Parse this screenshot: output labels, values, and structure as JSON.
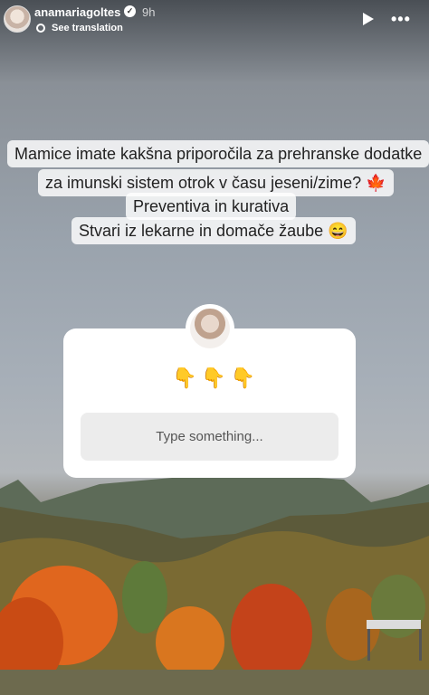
{
  "header": {
    "username": "anamariagoltes",
    "verified_icon": "verified-badge-icon",
    "time": "9h",
    "translate_label": "See translation",
    "play_icon": "play-icon",
    "more_icon": "more-dots-icon"
  },
  "question": {
    "lines": [
      "Mamice imate kakšna priporočila za prehranske dodatke",
      "za imunski sistem otrok v času jeseni/zime? 🍁",
      "Preventiva in kurativa",
      "Stvari iz lekarne in domače žaube 😄"
    ]
  },
  "response_card": {
    "emoji": "👇👇👇",
    "input_placeholder": "Type something..."
  },
  "colors": {
    "text_bg": "#ffffff",
    "input_bg": "#ececec",
    "foliage_orange": "#e0661e"
  }
}
